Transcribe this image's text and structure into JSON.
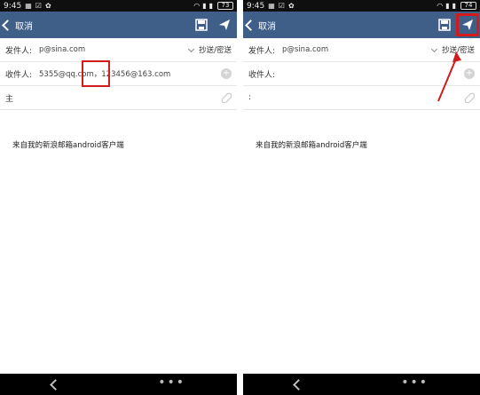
{
  "left": {
    "status": {
      "time": "9:45",
      "battery": "73"
    },
    "appbar": {
      "back_label": "取消"
    },
    "form": {
      "sender_label": "发件人:",
      "sender_value": "p@sina.com",
      "cc_bcc": "抄送/密送",
      "recipient_label": "收件人:",
      "recipient_value": "5355@qq.com，123456@163.com",
      "subject_label": "主"
    },
    "body": "来自我的新浪邮箱android客户端"
  },
  "right": {
    "status": {
      "time": "9:45",
      "battery": "74"
    },
    "appbar": {
      "back_label": "取消"
    },
    "form": {
      "sender_label": "发件人:",
      "sender_value": "p@sina.com",
      "cc_bcc": "抄送/密送",
      "recipient_label": "收件人:",
      "recipient_value": "",
      "subject_label": ":"
    },
    "body": "来自我的新浪邮箱android客户端"
  },
  "colors": {
    "appbar": "#3f5f88",
    "statusbar": "#0f0f0f",
    "navbar": "#000000",
    "highlight": "#d21b1b"
  },
  "icons": {
    "save": "save-icon",
    "send": "send-icon",
    "add": "add-circle-icon",
    "attach": "paperclip-icon",
    "back": "back-chevron-icon",
    "more": "more-dots-icon"
  }
}
